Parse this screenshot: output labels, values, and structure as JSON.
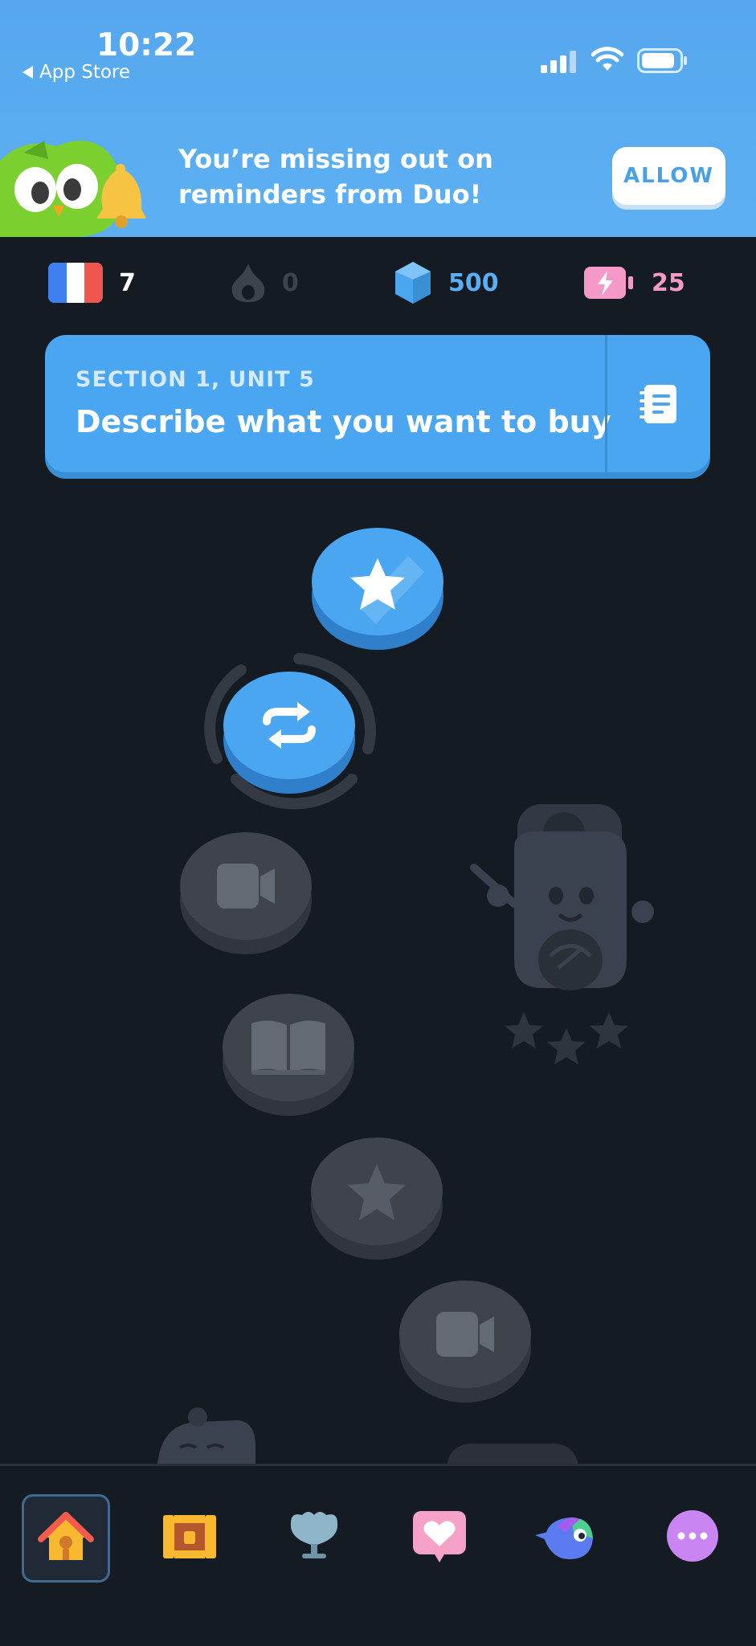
{
  "status_bar": {
    "time": "10:22",
    "back_label": "App Store"
  },
  "banner": {
    "message_line1": "You’re missing out on",
    "message_line2": "reminders from Duo!",
    "allow_label": "ALLOW"
  },
  "stats": {
    "course_flag": "france-flag-icon",
    "course_count": "7",
    "streak": "0",
    "gems": "500",
    "energy": "25"
  },
  "unit": {
    "section_label": "SECTION 1, UNIT 5",
    "title": "Describe what you want to buy"
  },
  "path_nodes": [
    {
      "icon": "star-icon",
      "state": "completed"
    },
    {
      "icon": "repeat-icon",
      "state": "current"
    },
    {
      "icon": "video-icon",
      "state": "locked"
    },
    {
      "icon": "book-icon",
      "state": "locked"
    },
    {
      "icon": "star-icon",
      "state": "locked"
    },
    {
      "icon": "video-icon",
      "state": "locked"
    }
  ],
  "nav": [
    {
      "icon": "home-icon",
      "selected": true
    },
    {
      "icon": "treasure-chest-icon",
      "selected": false
    },
    {
      "icon": "trophy-icon",
      "selected": false
    },
    {
      "icon": "heart-icon",
      "selected": false
    },
    {
      "icon": "bird-icon",
      "selected": false
    },
    {
      "icon": "more-icon",
      "selected": false
    }
  ],
  "colors": {
    "banner_blue": "#56a7ee",
    "card_blue": "#4aa6f0",
    "background": "#151b23",
    "gem_blue": "#5aaef3",
    "energy_pink": "#f59ac8",
    "locked_gray": "#3f444c"
  }
}
